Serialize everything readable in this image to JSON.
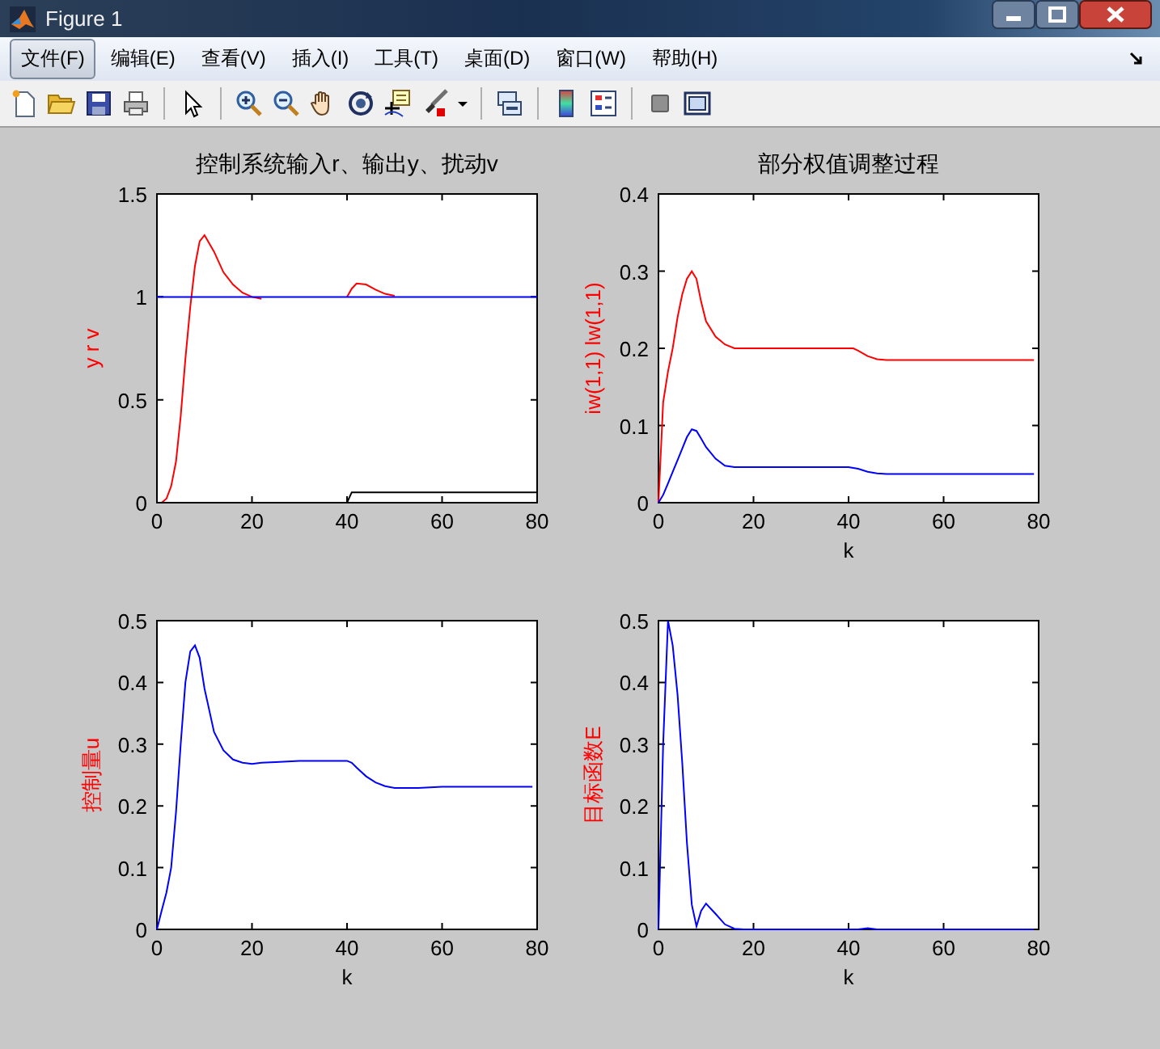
{
  "window": {
    "title": "Figure 1"
  },
  "menu": [
    {
      "label": "文件(F)",
      "selected": true
    },
    {
      "label": "编辑(E)",
      "selected": false
    },
    {
      "label": "查看(V)",
      "selected": false
    },
    {
      "label": "插入(I)",
      "selected": false
    },
    {
      "label": "工具(T)",
      "selected": false
    },
    {
      "label": "桌面(D)",
      "selected": false
    },
    {
      "label": "窗口(W)",
      "selected": false
    },
    {
      "label": "帮助(H)",
      "selected": false
    }
  ],
  "plots": [
    {
      "chart_data": {
        "type": "line",
        "title": "控制系统输入r、输出y、扰动v",
        "ylabel": "y r v",
        "x": [
          0,
          1,
          2,
          3,
          4,
          5,
          6,
          7,
          8,
          9,
          10,
          12,
          14,
          16,
          18,
          20,
          22,
          25,
          30,
          35,
          40,
          41,
          42,
          44,
          46,
          48,
          50,
          55,
          60,
          70,
          80
        ],
        "series": [
          {
            "color": "#ff0000",
            "values": [
              0,
              0,
              0.02,
              0.08,
              0.2,
              0.42,
              0.7,
              0.95,
              1.15,
              1.27,
              1.3,
              1.22,
              1.12,
              1.06,
              1.02,
              1,
              0.99,
              null,
              null,
              null,
              1,
              1.04,
              1.065,
              1.06,
              1.035,
              1.015,
              1.005,
              null,
              null,
              null,
              null
            ]
          },
          {
            "color": "#0000ff",
            "values": [
              1,
              1,
              1,
              1,
              1,
              1,
              1,
              1,
              1,
              1,
              1,
              1,
              1,
              1,
              1,
              1,
              1,
              1,
              1,
              1,
              1,
              1,
              1,
              1,
              1,
              1,
              1,
              1,
              1,
              1,
              1
            ]
          },
          {
            "color": "#000000",
            "values": [
              0,
              0,
              0,
              0,
              0,
              0,
              0,
              0,
              0,
              0,
              0,
              0,
              0,
              0,
              0,
              0,
              0,
              0,
              0,
              0,
              0,
              0.05,
              0.05,
              0.05,
              0.05,
              0.05,
              0.05,
              0.05,
              0.05,
              0.05,
              0.05
            ]
          }
        ],
        "xlim": [
          0,
          80
        ],
        "ylim": [
          0,
          1.5
        ],
        "xticks": [
          0,
          20,
          40,
          60,
          80
        ],
        "yticks": [
          0,
          0.5,
          1,
          1.5
        ]
      }
    },
    {
      "chart_data": {
        "type": "line",
        "title": "部分权值调整过程",
        "xlabel": "k",
        "ylabel": "iw(1,1)  lw(1,1)",
        "x": [
          0,
          1,
          2,
          3,
          4,
          5,
          6,
          7,
          8,
          9,
          10,
          12,
          14,
          16,
          18,
          20,
          22,
          25,
          30,
          35,
          40,
          41,
          42,
          44,
          46,
          48,
          50,
          55,
          60,
          70,
          79
        ],
        "series": [
          {
            "color": "#ff0000",
            "values": [
              0,
              0.13,
              0.17,
              0.2,
              0.24,
              0.27,
              0.29,
              0.3,
              0.29,
              0.26,
              0.235,
              0.215,
              0.205,
              0.2,
              0.2,
              0.2,
              0.2,
              0.2,
              0.2,
              0.2,
              0.2,
              0.2,
              0.197,
              0.19,
              0.186,
              0.185,
              0.185,
              0.185,
              0.185,
              0.185,
              0.185
            ]
          },
          {
            "color": "#0000ff",
            "values": [
              0,
              0.01,
              0.025,
              0.04,
              0.055,
              0.07,
              0.085,
              0.095,
              0.093,
              0.083,
              0.072,
              0.057,
              0.048,
              0.046,
              0.046,
              0.046,
              0.046,
              0.046,
              0.046,
              0.046,
              0.046,
              0.045,
              0.044,
              0.04,
              0.038,
              0.037,
              0.037,
              0.037,
              0.037,
              0.037,
              0.037
            ]
          }
        ],
        "xlim": [
          0,
          80
        ],
        "ylim": [
          0,
          0.4
        ],
        "xticks": [
          0,
          20,
          40,
          60,
          80
        ],
        "yticks": [
          0,
          0.1,
          0.2,
          0.3,
          0.4
        ]
      }
    },
    {
      "chart_data": {
        "type": "line",
        "xlabel": "k",
        "ylabel": "控制量u",
        "x": [
          0,
          1,
          2,
          3,
          4,
          5,
          6,
          7,
          8,
          9,
          10,
          12,
          14,
          16,
          18,
          20,
          22,
          25,
          30,
          35,
          40,
          41,
          42,
          44,
          46,
          48,
          50,
          55,
          60,
          70,
          79
        ],
        "series": [
          {
            "color": "#0000ff",
            "values": [
              0,
              0.03,
              0.06,
              0.1,
              0.19,
              0.3,
              0.4,
              0.45,
              0.46,
              0.44,
              0.39,
              0.32,
              0.29,
              0.275,
              0.27,
              0.268,
              0.27,
              0.271,
              0.273,
              0.273,
              0.273,
              0.27,
              0.262,
              0.248,
              0.238,
              0.232,
              0.229,
              0.229,
              0.231,
              0.231,
              0.231
            ]
          }
        ],
        "xlim": [
          0,
          80
        ],
        "ylim": [
          0,
          0.5
        ],
        "xticks": [
          0,
          20,
          40,
          60,
          80
        ],
        "yticks": [
          0,
          0.1,
          0.2,
          0.3,
          0.4,
          0.5
        ]
      }
    },
    {
      "chart_data": {
        "type": "line",
        "xlabel": "k",
        "ylabel": "目标函数E",
        "x": [
          0,
          1,
          2,
          3,
          4,
          5,
          6,
          7,
          8,
          9,
          10,
          12,
          14,
          16,
          18,
          20,
          22,
          25,
          30,
          35,
          40,
          41,
          42,
          44,
          46,
          48,
          50,
          55,
          60,
          70,
          79
        ],
        "series": [
          {
            "color": "#0000ff",
            "values": [
              0,
              0.3,
              0.5,
              0.46,
              0.38,
              0.27,
              0.14,
              0.04,
              0.005,
              0.03,
              0.042,
              0.025,
              0.008,
              0.001,
              0,
              0,
              0,
              0,
              0,
              0,
              0,
              0,
              0,
              0.002,
              0,
              0,
              0,
              0,
              0,
              0,
              0
            ]
          }
        ],
        "xlim": [
          0,
          80
        ],
        "ylim": [
          0,
          0.5
        ],
        "xticks": [
          0,
          20,
          40,
          60,
          80
        ],
        "yticks": [
          0,
          0.1,
          0.2,
          0.3,
          0.4,
          0.5
        ]
      }
    }
  ]
}
